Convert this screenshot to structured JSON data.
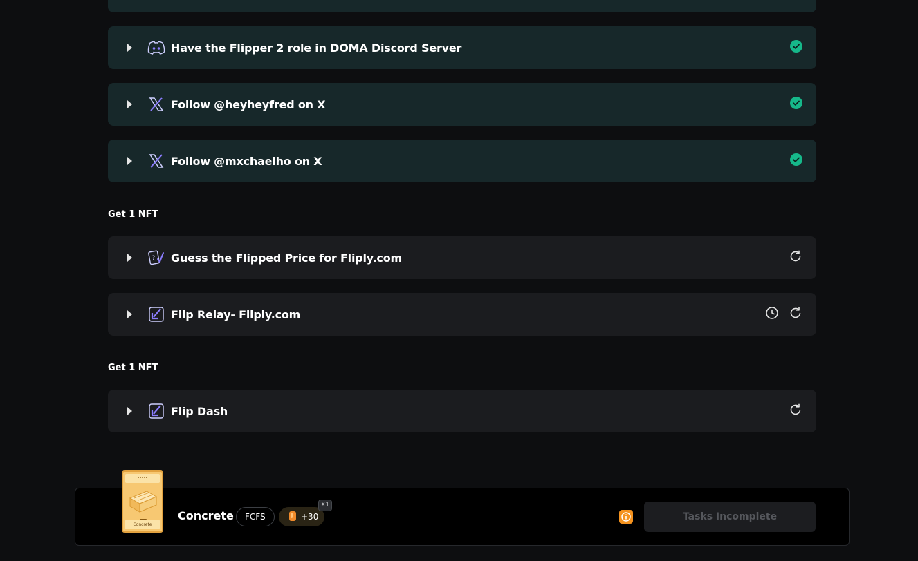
{
  "tasks_completed": [
    {
      "label": "Have the Flipper 2 role in DOMA Discord Server",
      "icon": "discord-icon",
      "status": "completed"
    },
    {
      "label": "Follow @heyheyfred on X",
      "icon": "x-icon",
      "status": "completed"
    },
    {
      "label": "Follow @mxchaelho on X",
      "icon": "x-icon",
      "status": "completed"
    }
  ],
  "section_1": {
    "title": "Get 1 NFT",
    "tasks": [
      {
        "label": "Guess the Flipped Price for Fliply.com",
        "icon": "guess-card-icon",
        "status": "refresh"
      },
      {
        "label": "Flip Relay- Fliply.com",
        "icon": "flip-arrow-icon",
        "status": "timed-refresh"
      }
    ]
  },
  "section_2": {
    "title": "Get 1 NFT",
    "tasks": [
      {
        "label": "Flip Dash",
        "icon": "flip-arrow-icon",
        "status": "refresh"
      }
    ]
  },
  "reward": {
    "name": "Concrete",
    "card_footer": "Concrete",
    "type_pill": "FCFS",
    "points": "+30",
    "multiplier": "X1",
    "button_label": "Tasks Incomplete"
  },
  "colors": {
    "completed_bg": "#17282a",
    "pending_bg": "#1b1c1f",
    "check_green": "#16b88a",
    "accent_purple": "#6b5cf6",
    "info_orange": "#f5931f"
  }
}
